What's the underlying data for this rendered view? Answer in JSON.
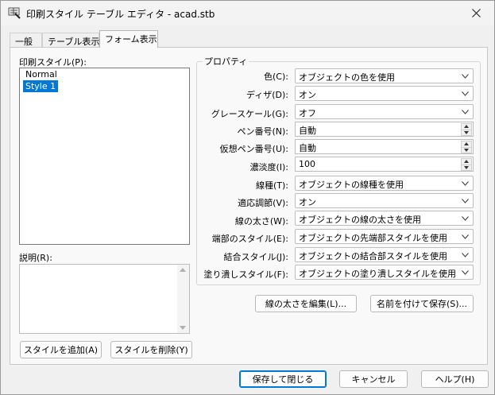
{
  "window": {
    "title": "印刷スタイル テーブル エディタ - acad.stb"
  },
  "tabs": [
    {
      "label": "一般"
    },
    {
      "label": "テーブル表示"
    },
    {
      "label": "フォーム表示"
    }
  ],
  "styles_panel": {
    "label": "印刷スタイル(P):",
    "items": [
      "Normal",
      "Style 1"
    ],
    "selected": "Style 1",
    "description_label": "説明(R):",
    "description_value": "",
    "add_button": "スタイルを追加(A)",
    "delete_button": "スタイルを削除(Y)"
  },
  "properties": {
    "group_title": "プロパティ",
    "rows": [
      {
        "label": "色(C):",
        "value": "オブジェクトの色を使用",
        "control": "combo"
      },
      {
        "label": "ディザ(D):",
        "value": "オン",
        "control": "combo"
      },
      {
        "label": "グレースケール(G):",
        "value": "オフ",
        "control": "combo"
      },
      {
        "label": "ペン番号(N):",
        "value": "自動",
        "control": "spin"
      },
      {
        "label": "仮想ペン番号(U):",
        "value": "自動",
        "control": "spin"
      },
      {
        "label": "濃淡度(I):",
        "value": "100",
        "control": "spin"
      },
      {
        "label": "線種(T):",
        "value": "オブジェクトの線種を使用",
        "control": "combo"
      },
      {
        "label": "適応調節(V):",
        "value": "オン",
        "control": "combo"
      },
      {
        "label": "線の太さ(W):",
        "value": "オブジェクトの線の太さを使用",
        "control": "combo"
      },
      {
        "label": "端部のスタイル(E):",
        "value": "オブジェクトの先端部スタイルを使用",
        "control": "combo"
      },
      {
        "label": "結合スタイル(J):",
        "value": "オブジェクトの結合部スタイルを使用",
        "control": "combo"
      },
      {
        "label": "塗り潰しスタイル(F):",
        "value": "オブジェクトの塗り潰しスタイルを使用",
        "control": "combo"
      }
    ],
    "edit_lineweights_button": "線の太さを編集(L)...",
    "save_as_button": "名前を付けて保存(S)..."
  },
  "footer": {
    "save_close_button": "保存して閉じる",
    "cancel_button": "キャンセル",
    "help_button": "ヘルプ(H)"
  },
  "colors": {
    "accent": "#0078d7",
    "selection": "#0078d7"
  }
}
